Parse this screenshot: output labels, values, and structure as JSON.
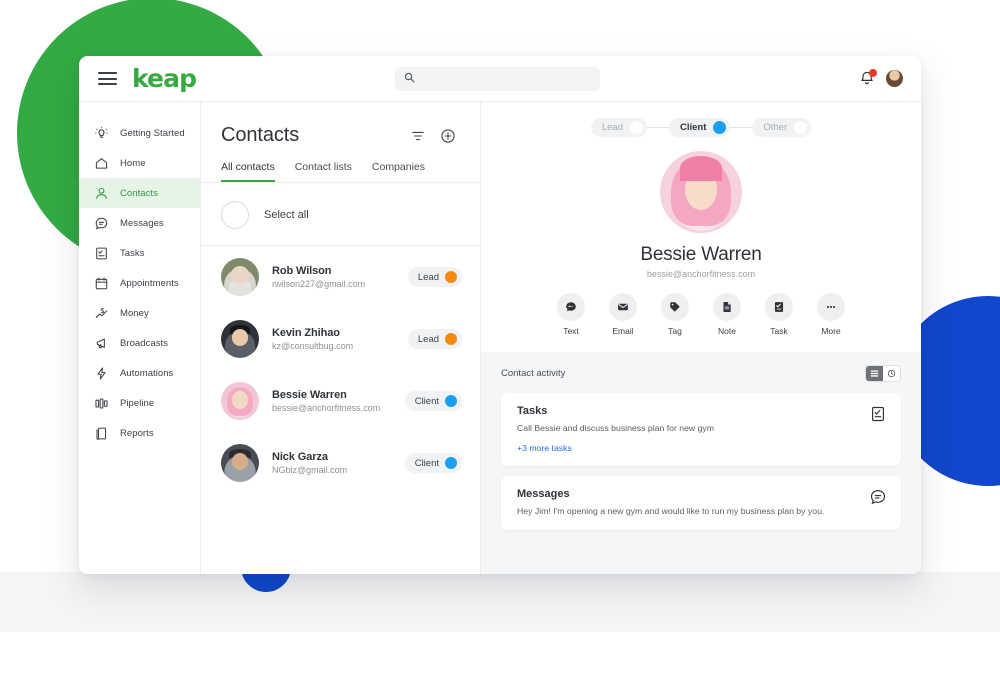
{
  "topbar": {
    "brand": "keap",
    "menu_icon": "hamburger-icon",
    "search": {
      "value": "",
      "placeholder": "",
      "icon": "search-icon"
    },
    "notifications_icon": "bell-icon",
    "avatar": "user-avatar"
  },
  "sidebar": {
    "items": [
      {
        "label": "Getting Started",
        "icon": "lightbulb-icon",
        "active": false
      },
      {
        "label": "Home",
        "icon": "home-icon",
        "active": false
      },
      {
        "label": "Contacts",
        "icon": "person-icon",
        "active": true
      },
      {
        "label": "Messages",
        "icon": "chat-bubble-icon",
        "active": false
      },
      {
        "label": "Tasks",
        "icon": "checklist-icon",
        "active": false
      },
      {
        "label": "Appointments",
        "icon": "calendar-icon",
        "active": false
      },
      {
        "label": "Money",
        "icon": "money-chart-icon",
        "active": false
      },
      {
        "label": "Broadcasts",
        "icon": "megaphone-icon",
        "active": false
      },
      {
        "label": "Automations",
        "icon": "lightning-icon",
        "active": false
      },
      {
        "label": "Pipeline",
        "icon": "pipeline-icon",
        "active": false
      },
      {
        "label": "Reports",
        "icon": "report-document-icon",
        "active": false
      }
    ]
  },
  "contacts_panel": {
    "title": "Contacts",
    "filter_icon": "filter-icon",
    "add_icon": "add-circle-icon",
    "tabs": [
      {
        "label": "All contacts",
        "active": true
      },
      {
        "label": "Contact lists",
        "active": false
      },
      {
        "label": "Companies",
        "active": false
      }
    ],
    "select_all_label": "Select all",
    "rows": [
      {
        "name": "Rob Wilson",
        "email": "rwilson227@gmail.com",
        "badge": "Lead",
        "badge_color": "#f78a0c",
        "avatar": "av-rob"
      },
      {
        "name": "Kevin Zhihao",
        "email": "kz@consultbug.com",
        "badge": "Lead",
        "badge_color": "#f78a0c",
        "avatar": "av-kevin"
      },
      {
        "name": "Bessie Warren",
        "email": "bessie@anchorfitness.com",
        "badge": "Client",
        "badge_color": "#17a0f0",
        "avatar": "av-bessie"
      },
      {
        "name": "Nick Garza",
        "email": "NGbiz@gmail.com",
        "badge": "Client",
        "badge_color": "#17a0f0",
        "avatar": "av-nick"
      }
    ]
  },
  "detail_panel": {
    "type_toggle": [
      {
        "label": "Lead",
        "selected": false
      },
      {
        "label": "Client",
        "selected": true
      },
      {
        "label": "Other",
        "selected": false
      }
    ],
    "selected_color": "#17a0f0",
    "name": "Bessie Warren",
    "email": "bessie@anchorfitness.com",
    "actions": [
      {
        "label": "Text",
        "icon": "chat-bubble-icon"
      },
      {
        "label": "Email",
        "icon": "envelope-icon"
      },
      {
        "label": "Tag",
        "icon": "tag-icon"
      },
      {
        "label": "Note",
        "icon": "note-icon"
      },
      {
        "label": "Task",
        "icon": "checklist-icon"
      },
      {
        "label": "More",
        "icon": "ellipsis-icon"
      }
    ],
    "activity": {
      "title": "Contact activity",
      "view_toggle": [
        {
          "icon": "list-view-icon",
          "active": true
        },
        {
          "icon": "clock-view-icon",
          "active": false
        }
      ],
      "cards": [
        {
          "title": "Tasks",
          "body": "Call Bessie and discuss business plan for new gym",
          "link": "+3 more tasks",
          "icon": "checklist-icon"
        },
        {
          "title": "Messages",
          "body": "Hey Jim! I'm opening a new gym and would like to run my business plan by you.",
          "link": "",
          "icon": "chat-bubble-icon"
        }
      ]
    }
  },
  "decor": {
    "green": "#33aa44",
    "blue": "#1047cc"
  }
}
